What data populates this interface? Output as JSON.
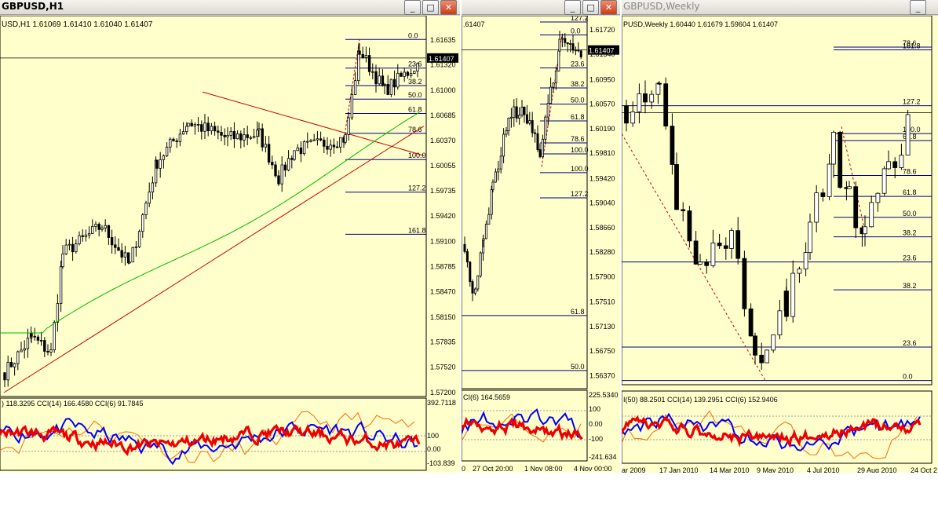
{
  "colors": {
    "panel_bg": "#ffffcc",
    "bull": "#ffffff",
    "bear": "#000000",
    "outline": "#000000",
    "fib": "#000080",
    "trend": "#cc0000",
    "ma": "#00bb00",
    "cci14": "#0000ff",
    "cci50": "#ee0000",
    "cci6": "#ff6600"
  },
  "windows": [
    {
      "title": "GBPUSD,H1",
      "active": true,
      "buttons": {
        "minimize_icon": "minimize-icon",
        "maximize_icon": "maximize-icon",
        "close_icon": "close-icon"
      },
      "chart_data": {
        "type": "candlestick",
        "symbol_line": "USD,H1  1.61069 1.61410 1.61040 1.61407",
        "ylim": [
          1.572,
          1.6184
        ],
        "y_ticks": [
          "1.61635",
          "1.61320",
          "1.61000",
          "1.60685",
          "1.60370",
          "1.60055",
          "1.59735",
          "1.59420",
          "1.59100",
          "1.58785",
          "1.58470",
          "1.58150",
          "1.57835",
          "1.57520",
          "1.57200"
        ],
        "current_price": "1.61407",
        "fib_levels": [
          {
            "label": "0.0",
            "price": 1.6164
          },
          {
            "label": "23.6",
            "price": 1.6128
          },
          {
            "label": "38.2",
            "price": 1.6106
          },
          {
            "label": "50.0",
            "price": 1.6089
          },
          {
            "label": "61.8",
            "price": 1.6071
          },
          {
            "label": "78.6",
            "price": 1.6046
          },
          {
            "label": "100.0",
            "price": 1.6013
          },
          {
            "label": "127.2",
            "price": 1.5972
          },
          {
            "label": "161.8",
            "price": 1.5919
          }
        ],
        "oscillator": {
          "legend": ") 118.3295  CCI(14) 166.4580  CCI(6) 91.7845",
          "ticks": [
            "392.7118",
            "100",
            "0.00",
            "-100",
            "-103.839"
          ]
        }
      }
    },
    {
      "title": "",
      "active": false,
      "buttons": {
        "minimize_icon": "minimize-icon",
        "maximize_icon": "maximize-icon",
        "close_icon": "close-icon"
      },
      "chart_data": {
        "type": "candlestick",
        "symbol_line": ".61407",
        "ylim": [
          1.5623,
          1.6184
        ],
        "y_ticks": [
          "1.61720",
          "1.61340",
          "1.60950",
          "1.60570",
          "1.60190",
          "1.59810",
          "1.59420",
          "1.59040",
          "1.58660",
          "1.58280",
          "1.57900",
          "1.57510",
          "1.57130",
          "1.56750",
          "1.56370"
        ],
        "current_price": "1.61407",
        "fib_levels": [
          {
            "label": "127.2",
            "price": 1.6184
          },
          {
            "label": "0.0",
            "price": 1.6164
          },
          {
            "label": "23.6",
            "price": 1.6113
          },
          {
            "label": "38.2",
            "price": 1.6082
          },
          {
            "label": "50.0",
            "price": 1.6057
          },
          {
            "label": "61.8",
            "price": 1.6031
          },
          {
            "label": "78.6",
            "price": 1.5997
          },
          {
            "label": "100.0",
            "price": 1.598
          },
          {
            "label": "100.0",
            "price": 1.5951
          },
          {
            "label": "127.2",
            "price": 1.5912
          },
          {
            "label": "61.8",
            "price": 1.573
          },
          {
            "label": "50.0",
            "price": 1.5645
          }
        ],
        "oscillator": {
          "legend": "CI(6) 164.5659",
          "ticks": [
            "225.5340",
            "100",
            "0.00",
            "-100",
            "-241.634"
          ]
        },
        "x_ticks": [
          "0",
          "27 Oct 20:00",
          "1 Nov 08:00",
          "4 Nov 00:00"
        ]
      }
    },
    {
      "title": "GBPUSD,Weekly",
      "active": false,
      "buttons": {
        "minimize_icon": "minimize-icon",
        "maximize_icon": "maximize-icon",
        "close_icon": "close-icon"
      },
      "chart_data": {
        "type": "candlestick",
        "symbol_line": "PUSD,Weekly  1.60440 1.61679 1.59604 1.61407",
        "ylim": [
          1.42,
          1.68
        ],
        "fib_levels": [
          {
            "label": "78.6",
            "price": 1.662
          },
          {
            "label": "161.8",
            "price": 1.66
          },
          {
            "label": "127.2",
            "price": 1.62
          },
          {
            "label": "100.0",
            "price": 1.6
          },
          {
            "label": "61.8",
            "price": 1.595
          },
          {
            "label": "78.6",
            "price": 1.57
          },
          {
            "label": "61.8",
            "price": 1.555
          },
          {
            "label": "50.0",
            "price": 1.54
          },
          {
            "label": "38.2",
            "price": 1.526
          },
          {
            "label": "23.6",
            "price": 1.508
          },
          {
            "label": "38.2",
            "price": 1.488
          },
          {
            "label": "23.6",
            "price": 1.447
          },
          {
            "label": "0.0",
            "price": 1.423
          }
        ],
        "oscillator": {
          "legend": "I(50) 88.2501  CCI(14) 139.2951  CCI(6) 152.9406",
          "ticks": []
        },
        "x_ticks": [
          "ar 2009",
          "17 Jan 2010",
          "14 Mar 2010",
          "9 May 2010",
          "4 Jul 2010",
          "29 Aug 2010",
          "24 Oct 2"
        ]
      }
    }
  ]
}
